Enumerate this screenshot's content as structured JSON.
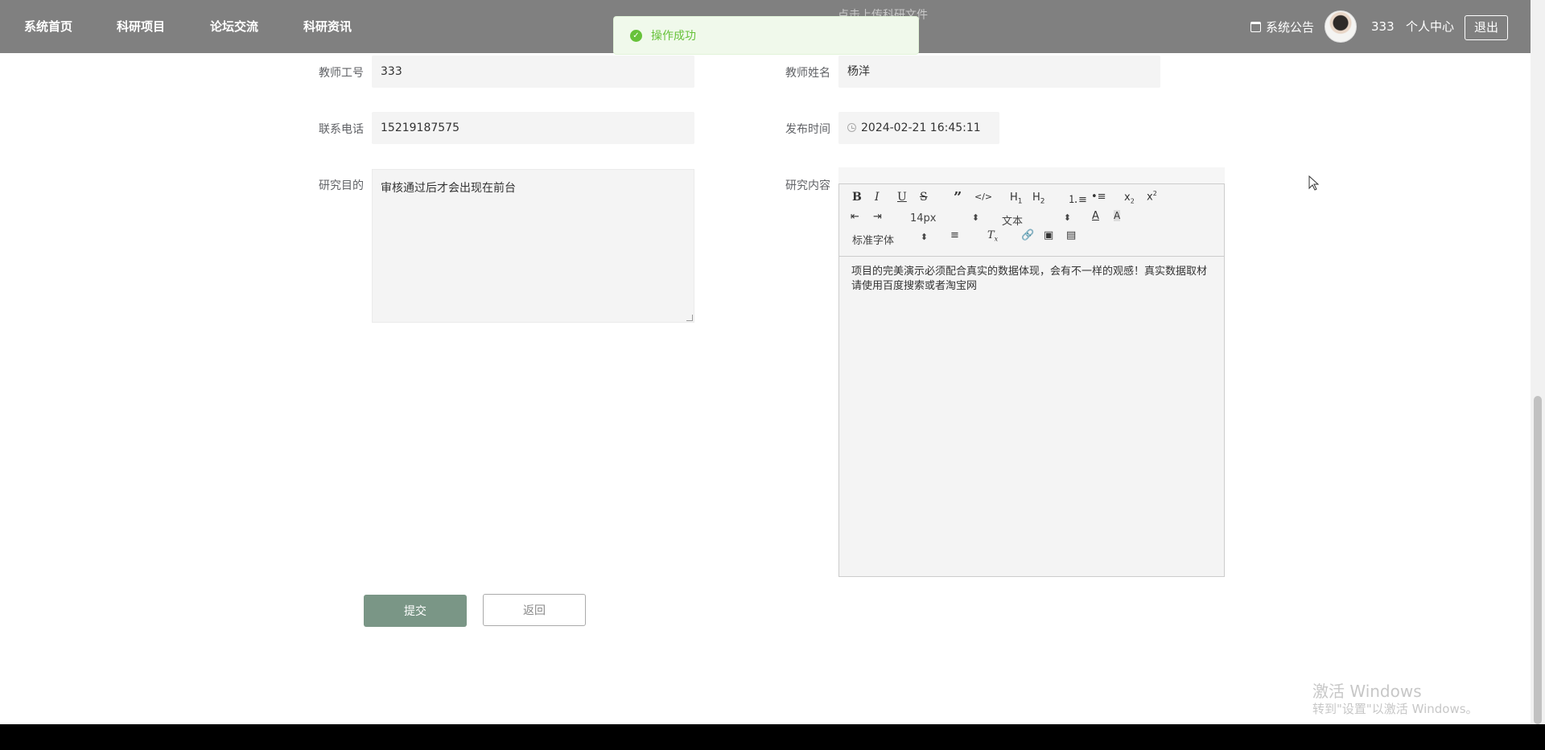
{
  "nav": {
    "items": [
      "系统首页",
      "科研项目",
      "论坛交流",
      "科研资讯"
    ],
    "ghost_upload_text": "点击上传科研文件",
    "notice": "系统公告",
    "username": "333",
    "personal_center": "个人中心",
    "logout": "退出"
  },
  "toast": {
    "message": "操作成功"
  },
  "form": {
    "teacher_id_label": "教师工号",
    "teacher_id_value": "333",
    "teacher_name_label": "教师姓名",
    "teacher_name_value": "杨洋",
    "phone_label": "联系电话",
    "phone_value": "15219187575",
    "publish_time_label": "发布时间",
    "publish_time_value": "2024-02-21 16:45:11",
    "purpose_label": "研究目的",
    "purpose_value": "审核通过后才会出现在前台",
    "content_label": "研究内容",
    "content_value": "项目的完美演示必须配合真实的数据体现，会有不一样的观感！真实数据取材请使用百度搜索或者淘宝网"
  },
  "editor": {
    "font_size": "14px",
    "header_picker": "文本",
    "font_picker": "标准字体",
    "tools": [
      "bold",
      "italic",
      "underline",
      "strike",
      "blockquote",
      "code-block",
      "h1",
      "h2",
      "ordered-list",
      "bullet-list",
      "subscript",
      "superscript",
      "outdent",
      "indent",
      "font-color",
      "background-color",
      "align",
      "clean",
      "link",
      "image",
      "video"
    ]
  },
  "buttons": {
    "submit": "提交",
    "back": "返回"
  },
  "watermark": {
    "line1": "激活 Windows",
    "line2": "转到\"设置\"以激活 Windows。"
  }
}
